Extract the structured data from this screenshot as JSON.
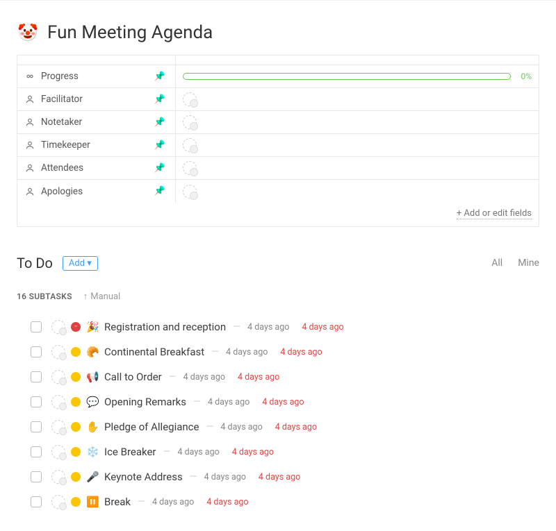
{
  "header": {
    "emoji": "🤡",
    "title": "Fun Meeting Agenda"
  },
  "fields": [
    {
      "icon": "progress",
      "label": "Progress",
      "kind": "progress",
      "percent": "0%"
    },
    {
      "icon": "person",
      "label": "Facilitator",
      "kind": "assignee"
    },
    {
      "icon": "person",
      "label": "Notetaker",
      "kind": "assignee"
    },
    {
      "icon": "person",
      "label": "Timekeeper",
      "kind": "assignee"
    },
    {
      "icon": "person",
      "label": "Attendees",
      "kind": "assignee"
    },
    {
      "icon": "person",
      "label": "Apologies",
      "kind": "assignee"
    }
  ],
  "addFieldsLabel": "+ Add or edit fields",
  "todo": {
    "title": "To Do",
    "addLabel": "Add ▾",
    "filters": {
      "all": "All",
      "mine": "Mine"
    },
    "countLabel": "16 SUBTASKS",
    "sortLabel": "Manual"
  },
  "tasks": [
    {
      "status": "red",
      "emoji": "🎉",
      "name": "Registration and reception",
      "date": "4 days ago",
      "due": "4 days ago"
    },
    {
      "status": "yellow",
      "emoji": "🥐",
      "name": "Continental Breakfast",
      "date": "4 days ago",
      "due": "4 days ago"
    },
    {
      "status": "yellow",
      "emoji": "📢",
      "name": "Call to Order",
      "date": "4 days ago",
      "due": "4 days ago"
    },
    {
      "status": "yellow",
      "emoji": "💬",
      "name": "Opening Remarks",
      "date": "4 days ago",
      "due": "4 days ago"
    },
    {
      "status": "yellow",
      "emoji": "✋",
      "name": "Pledge of Allegiance",
      "date": "4 days ago",
      "due": "4 days ago"
    },
    {
      "status": "yellow",
      "emoji": "❄️",
      "name": "Ice Breaker",
      "date": "4 days ago",
      "due": "4 days ago"
    },
    {
      "status": "yellow",
      "emoji": "🎤",
      "name": "Keynote Address",
      "date": "4 days ago",
      "due": "4 days ago"
    },
    {
      "status": "yellow",
      "emoji": "⏸️",
      "name": "Break",
      "date": "4 days ago",
      "due": "4 days ago"
    }
  ]
}
